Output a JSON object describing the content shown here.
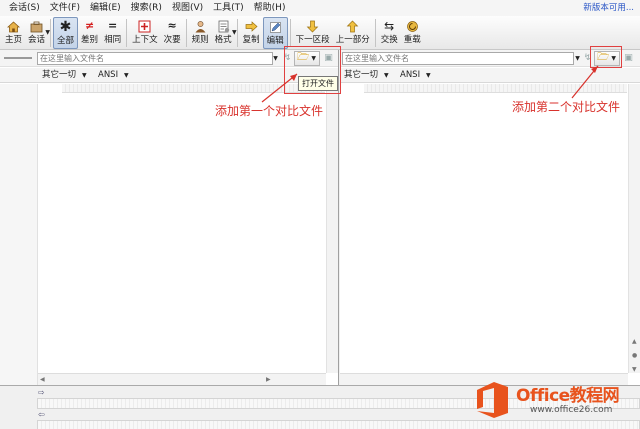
{
  "menubar": {
    "items": [
      "会话(S)",
      "文件(F)",
      "编辑(E)",
      "搜索(R)",
      "视图(V)",
      "工具(T)",
      "帮助(H)"
    ],
    "notice": "新版本可用..."
  },
  "toolbar": {
    "buttons": [
      {
        "label": "主页",
        "icon": "home-icon"
      },
      {
        "label": "会话",
        "icon": "session-icon"
      },
      {
        "label": "全部",
        "icon": "asterisk-icon"
      },
      {
        "label": "差别",
        "icon": "not-equal-icon"
      },
      {
        "label": "相同",
        "icon": "equal-icon"
      },
      {
        "label": "上下文",
        "icon": "context-icon"
      },
      {
        "label": "次要",
        "icon": "approx-icon"
      },
      {
        "label": "规则",
        "icon": "person-icon"
      },
      {
        "label": "格式",
        "icon": "format-icon"
      },
      {
        "label": "复制",
        "icon": "arrow-right-icon"
      },
      {
        "label": "编辑",
        "icon": "pencil-icon"
      },
      {
        "label": "下一区段",
        "icon": "arrow-down-icon"
      },
      {
        "label": "上一部分",
        "icon": "arrow-up-icon"
      },
      {
        "label": "交换",
        "icon": "swap-icon"
      },
      {
        "label": "重载",
        "icon": "reload-icon"
      }
    ]
  },
  "left_pane": {
    "path_placeholder": "在这里输入文件名",
    "filter": "其它一切",
    "encoding": "ANSI"
  },
  "right_pane": {
    "path_placeholder": "在这里输入文件名",
    "filter": "其它一切",
    "encoding": "ANSI"
  },
  "tooltip": "打开文件",
  "annotations": {
    "left": "添加第一个对比文件",
    "right": "添加第二个对比文件",
    "color": "#d8322c"
  },
  "watermark": {
    "brand": "Office教程网",
    "url": "www.office26.com"
  }
}
